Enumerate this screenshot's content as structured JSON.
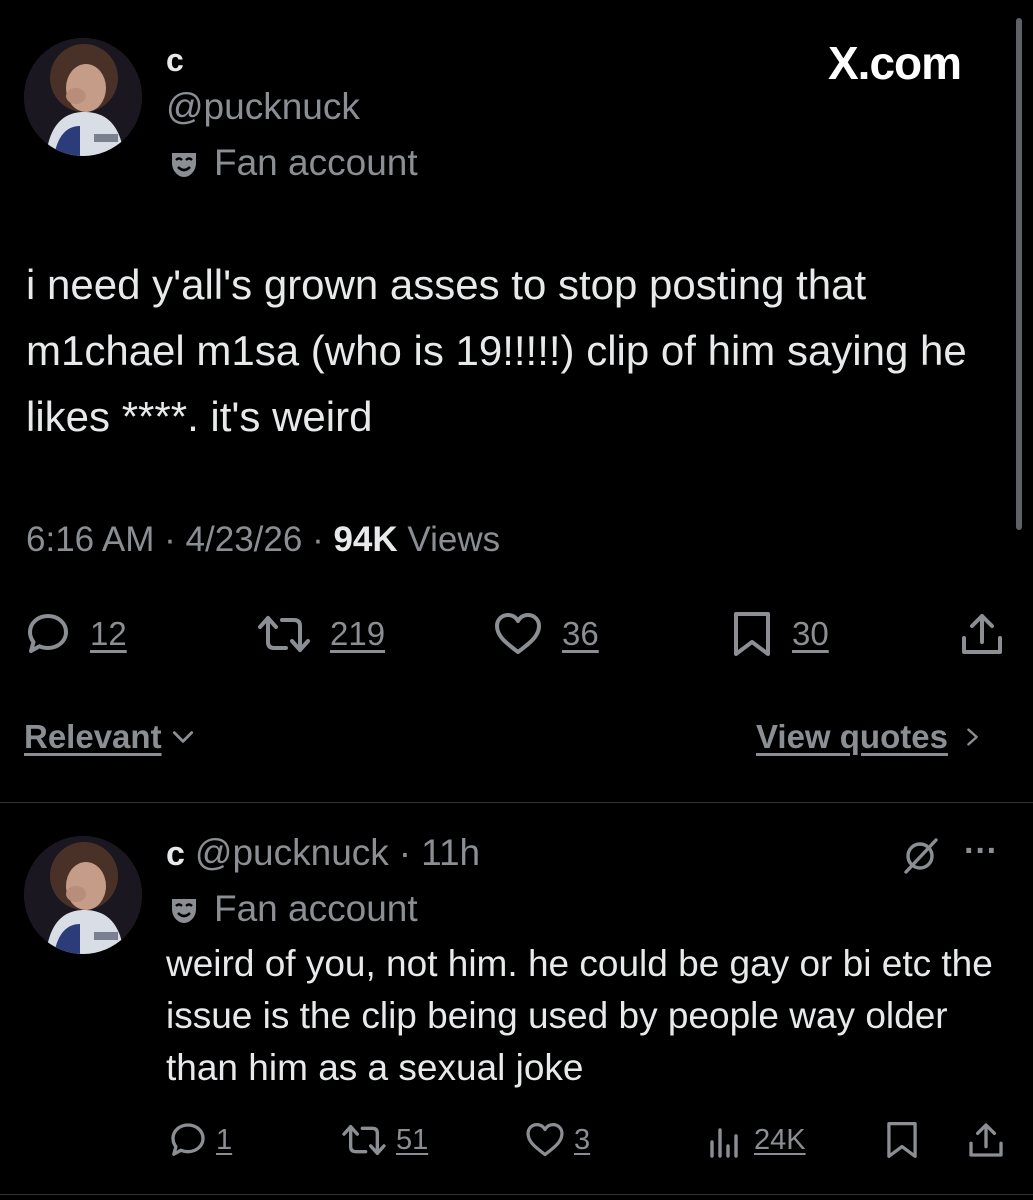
{
  "brand": {
    "watermark": "X.com"
  },
  "tweet": {
    "author_name": "c",
    "handle": "@pucknuck",
    "badge": "Fan account",
    "text": "i need y'all's grown asses to stop posting that m1chael m1sa (who is 19!!!!!) clip of him saying he likes ****. it's weird",
    "time": "6:16 AM",
    "date": "4/23/26",
    "views_count": "94K",
    "views_label": "Views",
    "separator": "·",
    "stats": {
      "replies": "12",
      "reposts": "219",
      "likes": "36",
      "bookmarks": "30"
    }
  },
  "sort": {
    "label": "Relevant"
  },
  "quotes_link": {
    "label": "View quotes"
  },
  "reply": {
    "author_name": "c",
    "handle": "@pucknuck",
    "separator": "·",
    "age": "11h",
    "badge": "Fan account",
    "more": "···",
    "text": "weird of you, not him. he could be gay or bi etc the issue is the clip being used by people way older than him as a sexual joke",
    "stats": {
      "replies": "1",
      "reposts": "51",
      "likes": "3",
      "views": "24K"
    }
  },
  "colors": {
    "background": "#000000",
    "text": "#e7e9ea",
    "muted": "#8b8f94",
    "divider": "#2f3336"
  }
}
